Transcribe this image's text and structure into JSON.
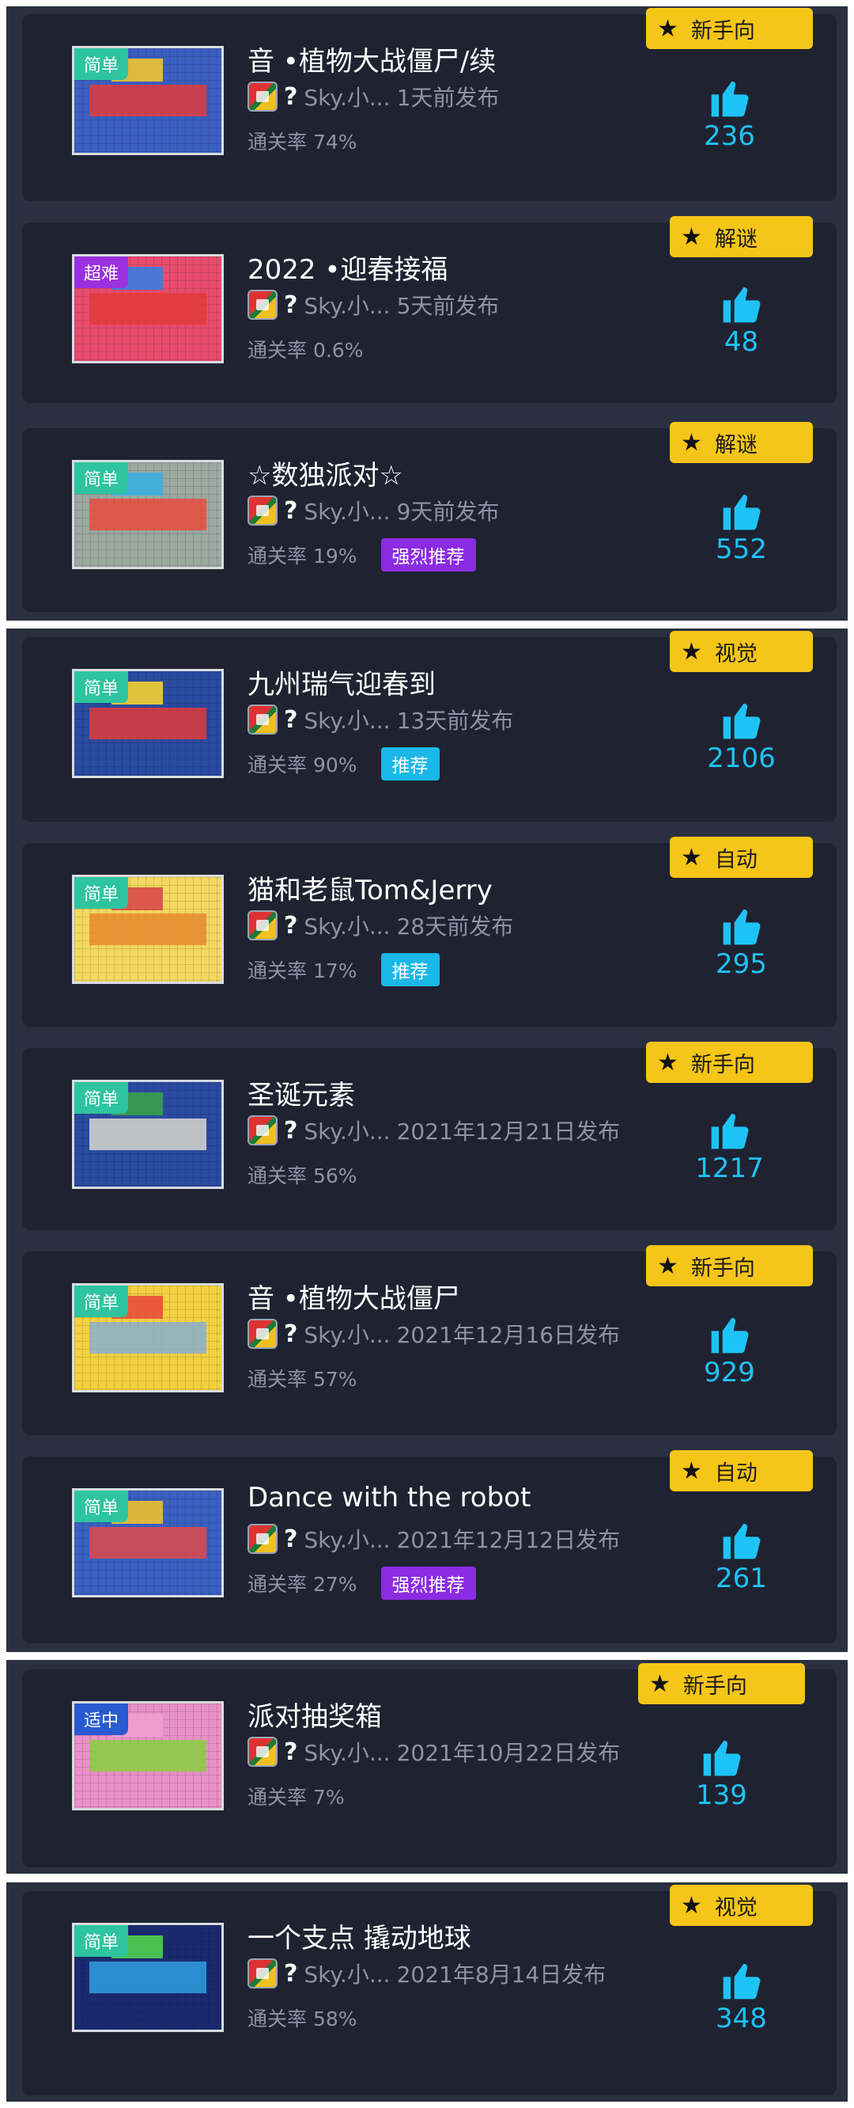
{
  "colors": {
    "category_bg": "#f5c518",
    "like_blue": "#1ec3f5",
    "card_bg": "#1f2231",
    "panel_bg": "#2b3040"
  },
  "levels": [
    {
      "difficulty": "简单",
      "difficulty_color": "#2ec4a0",
      "title": "音 •植物大战僵尸/续",
      "author": "Sky.小...",
      "published": "1天前发布",
      "pass_rate": "通关率 74%",
      "recommend": "",
      "recommend_color": "",
      "category": "新手向",
      "likes": "236",
      "thumb_colors": [
        "#3b5fc0",
        "#e23b3b",
        "#f2c230"
      ]
    },
    {
      "difficulty": "超难",
      "difficulty_color": "#9b30e0",
      "title": "2022 •迎春接福",
      "author": "Sky.小...",
      "published": "5天前发布",
      "pass_rate": "通关率 0.6%",
      "recommend": "",
      "recommend_color": "",
      "category": "解谜",
      "likes": "48",
      "thumb_colors": [
        "#e84c6e",
        "#e23b3b",
        "#3b7be0"
      ]
    },
    {
      "difficulty": "简单",
      "difficulty_color": "#2ec4a0",
      "title": "☆数独派对☆",
      "author": "Sky.小...",
      "published": "9天前发布",
      "pass_rate": "通关率 19%",
      "recommend": "强烈推荐",
      "recommend_color": "#8b2be2",
      "category": "解谜",
      "likes": "552",
      "thumb_colors": [
        "#9aa8a0",
        "#e84c3c",
        "#3bb0e0"
      ]
    },
    {
      "difficulty": "简单",
      "difficulty_color": "#2ec4a0",
      "title": "九州瑞气迎春到",
      "author": "Sky.小...",
      "published": "13天前发布",
      "pass_rate": "通关率 90%",
      "recommend": "推荐",
      "recommend_color": "#1ab8e8",
      "category": "视觉",
      "likes": "2106",
      "thumb_colors": [
        "#2a4aa0",
        "#e23b3b",
        "#f5d030"
      ]
    },
    {
      "difficulty": "简单",
      "difficulty_color": "#2ec4a0",
      "title": "猫和老鼠Tom&Jerry",
      "author": "Sky.小...",
      "published": "28天前发布",
      "pass_rate": "通关率 17%",
      "recommend": "推荐",
      "recommend_color": "#1ab8e8",
      "category": "自动",
      "likes": "295",
      "thumb_colors": [
        "#f2d860",
        "#e88a30",
        "#d84a4a"
      ]
    },
    {
      "difficulty": "简单",
      "difficulty_color": "#2ec4a0",
      "title": "圣诞元素",
      "author": "Sky.小...",
      "published": "2021年12月21日发布",
      "pass_rate": "通关率 56%",
      "recommend": "",
      "recommend_color": "",
      "category": "新手向",
      "likes": "1217",
      "thumb_colors": [
        "#2a4aa0",
        "#d8d8d0",
        "#3aa04a"
      ]
    },
    {
      "difficulty": "简单",
      "difficulty_color": "#2ec4a0",
      "title": "音 •植物大战僵尸",
      "author": "Sky.小...",
      "published": "2021年12月16日发布",
      "pass_rate": "通关率 57%",
      "recommend": "",
      "recommend_color": "",
      "category": "新手向",
      "likes": "929",
      "thumb_colors": [
        "#f2d040",
        "#8ab0d0",
        "#e84c3c"
      ]
    },
    {
      "difficulty": "简单",
      "difficulty_color": "#2ec4a0",
      "title": "Dance with the robot",
      "author": "Sky.小...",
      "published": "2021年12月12日发布",
      "pass_rate": "通关率 27%",
      "recommend": "强烈推荐",
      "recommend_color": "#8b2be2",
      "category": "自动",
      "likes": "261",
      "thumb_colors": [
        "#3a60c0",
        "#e04a4a",
        "#f0c030"
      ]
    },
    {
      "difficulty": "适中",
      "difficulty_color": "#2a5ad0",
      "title": "派对抽奖箱",
      "author": "Sky.小...",
      "published": "2021年10月22日发布",
      "pass_rate": "通关率 7%",
      "recommend": "",
      "recommend_color": "",
      "category": "新手向",
      "likes": "139",
      "thumb_colors": [
        "#e890c8",
        "#8ad040",
        "#f0a0d0"
      ]
    },
    {
      "difficulty": "简单",
      "difficulty_color": "#2ec4a0",
      "title": "一个支点 撬动地球",
      "author": "Sky.小...",
      "published": "2021年8月14日发布",
      "pass_rate": "通关率 58%",
      "recommend": "",
      "recommend_color": "",
      "category": "视觉",
      "likes": "348",
      "thumb_colors": [
        "#1a2a70",
        "#30a0e0",
        "#50d050"
      ]
    }
  ]
}
